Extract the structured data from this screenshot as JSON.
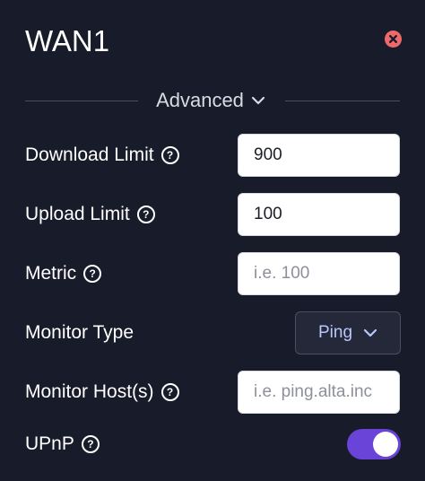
{
  "panel": {
    "title": "WAN1"
  },
  "section": {
    "label": "Advanced"
  },
  "fields": {
    "download_limit": {
      "label": "Download Limit",
      "value": "900",
      "placeholder": ""
    },
    "upload_limit": {
      "label": "Upload Limit",
      "value": "100",
      "placeholder": ""
    },
    "metric": {
      "label": "Metric",
      "value": "",
      "placeholder": "i.e. 100"
    },
    "monitor_type": {
      "label": "Monitor Type",
      "selected": "Ping"
    },
    "monitor_hosts": {
      "label": "Monitor Host(s)",
      "value": "",
      "placeholder": "i.e. ping.alta.inc"
    },
    "upnp": {
      "label": "UPnP",
      "enabled": true
    }
  },
  "icons": {
    "close": "close-icon",
    "help": "help-icon",
    "chevron": "chevron-down-icon"
  },
  "colors": {
    "background": "#181b29",
    "close": "#ee6a6a",
    "toggle_on": "#6a43d8",
    "select_text": "#b9c7ff"
  }
}
